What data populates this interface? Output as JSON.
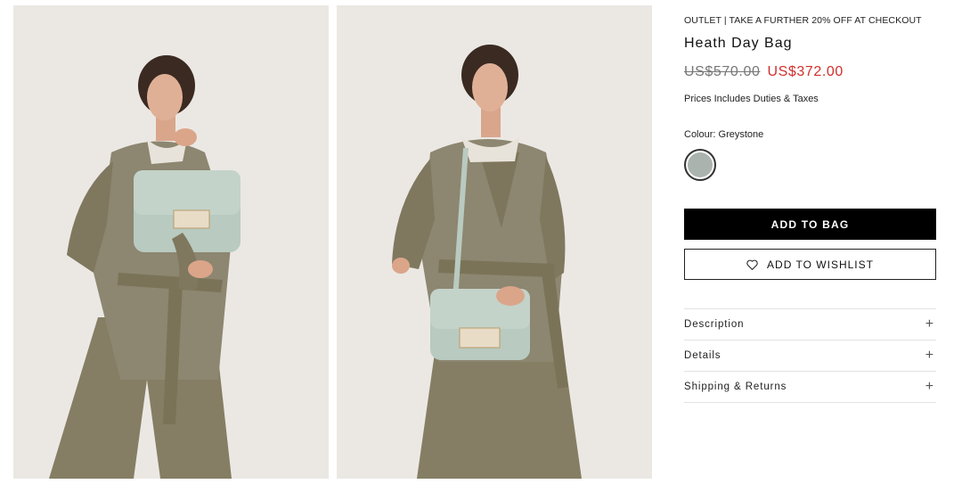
{
  "product": {
    "promo": "OUTLET | TAKE A FURTHER 20% OFF AT CHECKOUT",
    "title": "Heath Day Bag",
    "old_price": "US$570.00",
    "new_price": "US$372.00",
    "duties_note": "Prices Includes Duties & Taxes",
    "colour_label": "Colour: Greystone",
    "swatch_color": "#aab3ae"
  },
  "actions": {
    "add_to_bag": "ADD TO BAG",
    "add_to_wishlist": "ADD TO WISHLIST"
  },
  "accordion": [
    {
      "label": "Description"
    },
    {
      "label": "Details"
    },
    {
      "label": "Shipping & Returns"
    }
  ],
  "colors": {
    "price_sale": "#d0302d",
    "photo_bg": "#ebe8e4",
    "outfit": "#8a8368",
    "bag": "#b9cac0"
  },
  "icons": [
    "heart-icon",
    "plus-icon"
  ]
}
